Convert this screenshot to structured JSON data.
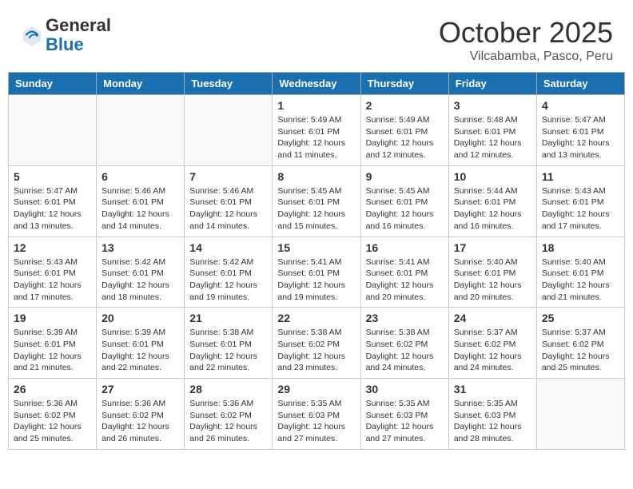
{
  "header": {
    "logo_general": "General",
    "logo_blue": "Blue",
    "month": "October 2025",
    "location": "Vilcabamba, Pasco, Peru"
  },
  "days_of_week": [
    "Sunday",
    "Monday",
    "Tuesday",
    "Wednesday",
    "Thursday",
    "Friday",
    "Saturday"
  ],
  "weeks": [
    [
      {
        "day": "",
        "info": ""
      },
      {
        "day": "",
        "info": ""
      },
      {
        "day": "",
        "info": ""
      },
      {
        "day": "1",
        "info": "Sunrise: 5:49 AM\nSunset: 6:01 PM\nDaylight: 12 hours\nand 11 minutes."
      },
      {
        "day": "2",
        "info": "Sunrise: 5:49 AM\nSunset: 6:01 PM\nDaylight: 12 hours\nand 12 minutes."
      },
      {
        "day": "3",
        "info": "Sunrise: 5:48 AM\nSunset: 6:01 PM\nDaylight: 12 hours\nand 12 minutes."
      },
      {
        "day": "4",
        "info": "Sunrise: 5:47 AM\nSunset: 6:01 PM\nDaylight: 12 hours\nand 13 minutes."
      }
    ],
    [
      {
        "day": "5",
        "info": "Sunrise: 5:47 AM\nSunset: 6:01 PM\nDaylight: 12 hours\nand 13 minutes."
      },
      {
        "day": "6",
        "info": "Sunrise: 5:46 AM\nSunset: 6:01 PM\nDaylight: 12 hours\nand 14 minutes."
      },
      {
        "day": "7",
        "info": "Sunrise: 5:46 AM\nSunset: 6:01 PM\nDaylight: 12 hours\nand 14 minutes."
      },
      {
        "day": "8",
        "info": "Sunrise: 5:45 AM\nSunset: 6:01 PM\nDaylight: 12 hours\nand 15 minutes."
      },
      {
        "day": "9",
        "info": "Sunrise: 5:45 AM\nSunset: 6:01 PM\nDaylight: 12 hours\nand 16 minutes."
      },
      {
        "day": "10",
        "info": "Sunrise: 5:44 AM\nSunset: 6:01 PM\nDaylight: 12 hours\nand 16 minutes."
      },
      {
        "day": "11",
        "info": "Sunrise: 5:43 AM\nSunset: 6:01 PM\nDaylight: 12 hours\nand 17 minutes."
      }
    ],
    [
      {
        "day": "12",
        "info": "Sunrise: 5:43 AM\nSunset: 6:01 PM\nDaylight: 12 hours\nand 17 minutes."
      },
      {
        "day": "13",
        "info": "Sunrise: 5:42 AM\nSunset: 6:01 PM\nDaylight: 12 hours\nand 18 minutes."
      },
      {
        "day": "14",
        "info": "Sunrise: 5:42 AM\nSunset: 6:01 PM\nDaylight: 12 hours\nand 19 minutes."
      },
      {
        "day": "15",
        "info": "Sunrise: 5:41 AM\nSunset: 6:01 PM\nDaylight: 12 hours\nand 19 minutes."
      },
      {
        "day": "16",
        "info": "Sunrise: 5:41 AM\nSunset: 6:01 PM\nDaylight: 12 hours\nand 20 minutes."
      },
      {
        "day": "17",
        "info": "Sunrise: 5:40 AM\nSunset: 6:01 PM\nDaylight: 12 hours\nand 20 minutes."
      },
      {
        "day": "18",
        "info": "Sunrise: 5:40 AM\nSunset: 6:01 PM\nDaylight: 12 hours\nand 21 minutes."
      }
    ],
    [
      {
        "day": "19",
        "info": "Sunrise: 5:39 AM\nSunset: 6:01 PM\nDaylight: 12 hours\nand 21 minutes."
      },
      {
        "day": "20",
        "info": "Sunrise: 5:39 AM\nSunset: 6:01 PM\nDaylight: 12 hours\nand 22 minutes."
      },
      {
        "day": "21",
        "info": "Sunrise: 5:38 AM\nSunset: 6:01 PM\nDaylight: 12 hours\nand 22 minutes."
      },
      {
        "day": "22",
        "info": "Sunrise: 5:38 AM\nSunset: 6:02 PM\nDaylight: 12 hours\nand 23 minutes."
      },
      {
        "day": "23",
        "info": "Sunrise: 5:38 AM\nSunset: 6:02 PM\nDaylight: 12 hours\nand 24 minutes."
      },
      {
        "day": "24",
        "info": "Sunrise: 5:37 AM\nSunset: 6:02 PM\nDaylight: 12 hours\nand 24 minutes."
      },
      {
        "day": "25",
        "info": "Sunrise: 5:37 AM\nSunset: 6:02 PM\nDaylight: 12 hours\nand 25 minutes."
      }
    ],
    [
      {
        "day": "26",
        "info": "Sunrise: 5:36 AM\nSunset: 6:02 PM\nDaylight: 12 hours\nand 25 minutes."
      },
      {
        "day": "27",
        "info": "Sunrise: 5:36 AM\nSunset: 6:02 PM\nDaylight: 12 hours\nand 26 minutes."
      },
      {
        "day": "28",
        "info": "Sunrise: 5:36 AM\nSunset: 6:02 PM\nDaylight: 12 hours\nand 26 minutes."
      },
      {
        "day": "29",
        "info": "Sunrise: 5:35 AM\nSunset: 6:03 PM\nDaylight: 12 hours\nand 27 minutes."
      },
      {
        "day": "30",
        "info": "Sunrise: 5:35 AM\nSunset: 6:03 PM\nDaylight: 12 hours\nand 27 minutes."
      },
      {
        "day": "31",
        "info": "Sunrise: 5:35 AM\nSunset: 6:03 PM\nDaylight: 12 hours\nand 28 minutes."
      },
      {
        "day": "",
        "info": ""
      }
    ]
  ]
}
